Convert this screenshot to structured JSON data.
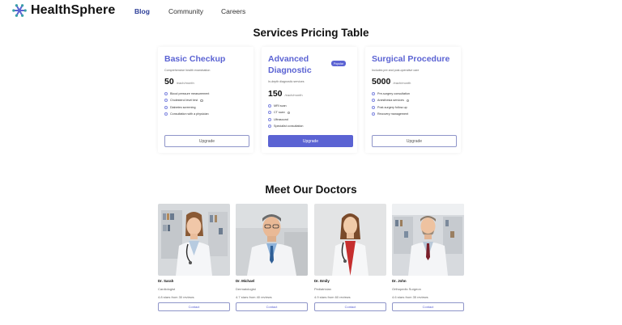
{
  "brand": {
    "name": "HealthSphere",
    "accent": "#5b63d3",
    "nav_active": "#2c3e98"
  },
  "nav": {
    "links": [
      {
        "label": "Blog",
        "active": true
      },
      {
        "label": "Community",
        "active": false
      },
      {
        "label": "Careers",
        "active": false
      }
    ]
  },
  "pricing": {
    "title": "Services Pricing Table",
    "plans": [
      {
        "name": "Basic Checkup",
        "description": "Comprehensive health examination",
        "price": "50",
        "per": "/each/month",
        "badge": "",
        "features": [
          {
            "text": "Blood pressure measurement",
            "info": false
          },
          {
            "text": "Cholesterol level test",
            "info": true
          },
          {
            "text": "Diabetes screening",
            "info": false
          },
          {
            "text": "Consultation with a physician",
            "info": false
          }
        ],
        "button": "Upgrade",
        "highlighted": false
      },
      {
        "name": "Advanced Diagnostic",
        "description": "In-depth diagnostic services",
        "price": "150",
        "per": "/each/month",
        "badge": "Popular",
        "features": [
          {
            "text": "MRI scan",
            "info": false
          },
          {
            "text": "CT scan",
            "info": true
          },
          {
            "text": "Ultrasound",
            "info": false
          },
          {
            "text": "Specialist consultation",
            "info": false
          }
        ],
        "button": "Upgrade",
        "highlighted": true
      },
      {
        "name": "Surgical Procedure",
        "description": "Includes pre and post-operative care",
        "price": "5000",
        "per": "/each/month",
        "badge": "",
        "features": [
          {
            "text": "Pre-surgery consultation",
            "info": false
          },
          {
            "text": "Anesthesia services",
            "info": true
          },
          {
            "text": "Post-surgery follow-up",
            "info": false
          },
          {
            "text": "Recovery management",
            "info": false
          }
        ],
        "button": "Upgrade",
        "highlighted": false
      }
    ]
  },
  "doctors": {
    "title": "Meet Our Doctors",
    "items": [
      {
        "name": "Dr. Sarah",
        "specialty": "Cardiologist",
        "rating": "4.8 stars from 30 reviews",
        "button": "Contact"
      },
      {
        "name": "Dr. Michael",
        "specialty": "Dermatologist",
        "rating": "4.7 stars from 40 reviews",
        "button": "Contact"
      },
      {
        "name": "Dr. Emily",
        "specialty": "Pediatrician",
        "rating": "4.9 stars from 60 reviews",
        "button": "Contact"
      },
      {
        "name": "Dr. John",
        "specialty": "Orthopedic Surgeon",
        "rating": "4.6 stars from 35 reviews",
        "button": "Contact"
      }
    ]
  }
}
